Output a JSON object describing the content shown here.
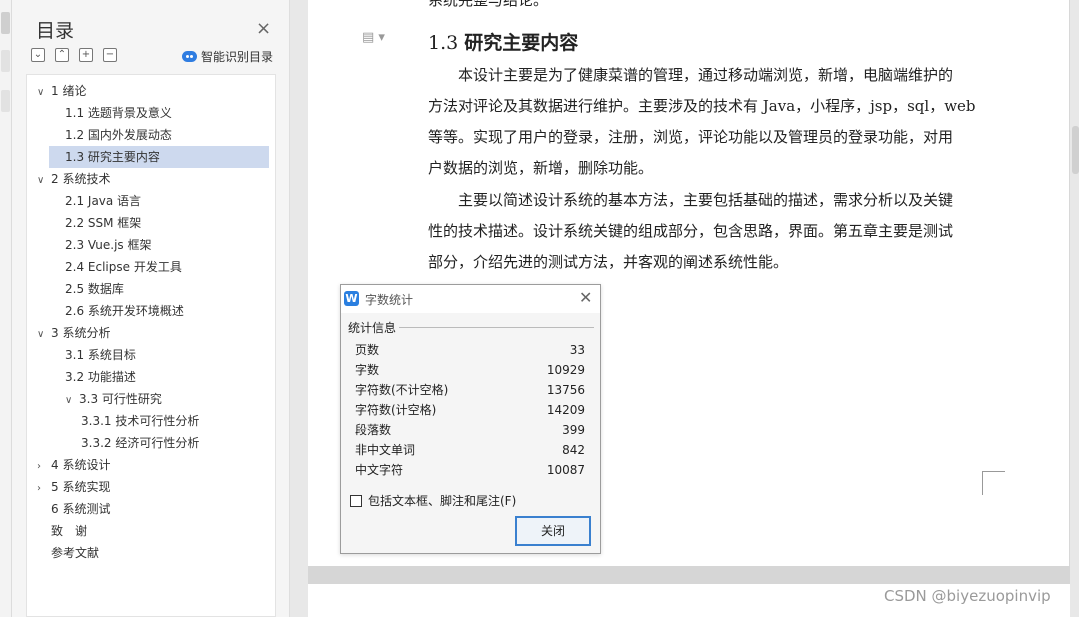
{
  "toc": {
    "title": "目录",
    "close_glyph": "×",
    "tools": [
      "⌄",
      "⌃",
      "+",
      "−"
    ],
    "smart_label": "智能识别目录",
    "items": [
      {
        "label": "1 绪论",
        "arrow": "∨",
        "level": 0,
        "selected": false
      },
      {
        "label": "1.1 选题背景及意义",
        "arrow": "",
        "level": 1,
        "selected": false
      },
      {
        "label": "1.2 国内外发展动态",
        "arrow": "",
        "level": 1,
        "selected": false
      },
      {
        "label": "1.3 研究主要内容",
        "arrow": "",
        "level": 1,
        "selected": true
      },
      {
        "label": "2 系统技术",
        "arrow": "∨",
        "level": 0,
        "selected": false
      },
      {
        "label": "2.1 Java 语言",
        "arrow": "",
        "level": 1,
        "selected": false
      },
      {
        "label": "2.2 SSM 框架",
        "arrow": "",
        "level": 1,
        "selected": false
      },
      {
        "label": "2.3 Vue.js 框架",
        "arrow": "",
        "level": 1,
        "selected": false
      },
      {
        "label": "2.4 Eclipse 开发工具",
        "arrow": "",
        "level": 1,
        "selected": false
      },
      {
        "label": "2.5 数据库",
        "arrow": "",
        "level": 1,
        "selected": false
      },
      {
        "label": "2.6 系统开发环境概述",
        "arrow": "",
        "level": 1,
        "selected": false
      },
      {
        "label": "3 系统分析",
        "arrow": "∨",
        "level": 0,
        "selected": false
      },
      {
        "label": "3.1 系统目标",
        "arrow": "",
        "level": 1,
        "selected": false
      },
      {
        "label": "3.2 功能描述",
        "arrow": "",
        "level": 1,
        "selected": false
      },
      {
        "label": "3.3 可行性研究",
        "arrow": "∨",
        "level": 1,
        "selected": false
      },
      {
        "label": "3.3.1 技术可行性分析",
        "arrow": "",
        "level": 2,
        "selected": false
      },
      {
        "label": "3.3.2 经济可行性分析",
        "arrow": "",
        "level": 2,
        "selected": false
      },
      {
        "label": "4 系统设计",
        "arrow": "›",
        "level": 0,
        "selected": false
      },
      {
        "label": "5 系统实现",
        "arrow": "›",
        "level": 0,
        "selected": false
      },
      {
        "label": "6 系统测试",
        "arrow": "",
        "level": 0,
        "selected": false
      },
      {
        "label": "致　谢",
        "arrow": "",
        "level": 0,
        "selected": false
      },
      {
        "label": "参考文献",
        "arrow": "",
        "level": 0,
        "selected": false
      }
    ]
  },
  "document": {
    "clipped_top_text": "系统完整与结论。",
    "heading_number": "1.3 ",
    "heading_text": "研究主要内容",
    "para1_lines": [
      "　　本设计主要是为了健康菜谱的管理，通过移动端浏览，新增，电脑端维护的",
      "方法对评论及其数据进行维护。主要涉及的技术有 Java，小程序，jsp，sql，web",
      "等等。实现了用户的登录，注册，浏览，评论功能以及管理员的登录功能，对用",
      "户数据的浏览，新增，删除功能。"
    ],
    "para2_lines": [
      "　　主要以简述设计系统的基本方法，主要包括基础的描述，需求分析以及关键",
      "性的技术描述。设计系统关键的组成部分，包含思路，界面。第五章主要是测试",
      "部分，介绍先进的测试方法，并客观的阐述系统性能。"
    ]
  },
  "dialog": {
    "logo": "W",
    "title": "字数统计",
    "close_glyph": "✕",
    "section": "统计信息",
    "stats": [
      {
        "label": "页数",
        "value": "33"
      },
      {
        "label": "字数",
        "value": "10929"
      },
      {
        "label": "字符数(不计空格)",
        "value": "13756"
      },
      {
        "label": "字符数(计空格)",
        "value": "14209"
      },
      {
        "label": "段落数",
        "value": "399"
      },
      {
        "label": "非中文单词",
        "value": "842"
      },
      {
        "label": "中文字符",
        "value": "10087"
      }
    ],
    "checkbox_label": "包括文本框、脚注和尾注(F)",
    "checkbox_checked": false,
    "close_button": "关闭"
  },
  "watermark": "CSDN @biyezuopinvip"
}
